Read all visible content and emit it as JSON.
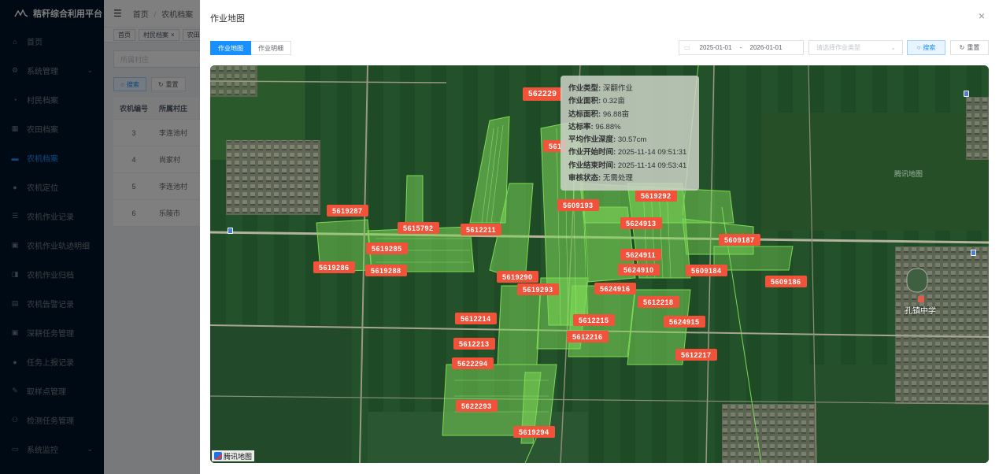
{
  "app": {
    "title": "秸秆综合利用平台"
  },
  "sidebar": {
    "items": [
      {
        "label": "首页",
        "icon": "home-icon",
        "glyph": "⌂"
      },
      {
        "label": "系统管理",
        "icon": "gear-icon",
        "glyph": "⚙",
        "arrow": "⌄"
      },
      {
        "label": "村民档案",
        "icon": "user-icon",
        "glyph": "◔"
      },
      {
        "label": "农田档案",
        "icon": "field-icon",
        "glyph": "▦"
      },
      {
        "label": "农机档案",
        "icon": "tractor-icon",
        "glyph": "▬",
        "active": true
      },
      {
        "label": "农机定位",
        "icon": "location-icon",
        "glyph": "●"
      },
      {
        "label": "农机作业记录",
        "icon": "record-icon",
        "glyph": "☰"
      },
      {
        "label": "农机作业轨迹明细",
        "icon": "track-icon",
        "glyph": "▣"
      },
      {
        "label": "农机作业归档",
        "icon": "archive-icon",
        "glyph": "◨"
      },
      {
        "label": "农机告警记录",
        "icon": "alarm-icon",
        "glyph": "▤"
      },
      {
        "label": "深耕任务管理",
        "icon": "task-icon",
        "glyph": "▣"
      },
      {
        "label": "任务上报记录",
        "icon": "report-icon",
        "glyph": "●"
      },
      {
        "label": "取样点管理",
        "icon": "sample-icon",
        "glyph": "✎"
      },
      {
        "label": "检测任务管理",
        "icon": "detect-icon",
        "glyph": "⚇"
      },
      {
        "label": "系统监控",
        "icon": "monitor-icon",
        "glyph": "▭",
        "arrow": "⌄"
      }
    ]
  },
  "background": {
    "breadcrumb": [
      "首页",
      "农机档案"
    ],
    "tags": [
      "首页",
      "村民档案",
      "农田"
    ],
    "filter_placeholder": "所属村庄",
    "search_label": "搜索",
    "reset_label": "重置",
    "table": {
      "headers": [
        "农机编号",
        "所属村庄"
      ],
      "rows": [
        [
          "3",
          "李连池村"
        ],
        [
          "4",
          "尚家村"
        ],
        [
          "5",
          "李连池村"
        ],
        [
          "6",
          "乐陵市"
        ]
      ]
    }
  },
  "modal": {
    "title": "作业地图",
    "close": "×",
    "tabs": [
      {
        "label": "作业地图",
        "active": true
      },
      {
        "label": "作业明细",
        "active": false
      }
    ],
    "date_start": "2025-01-01",
    "date_sep": "-",
    "date_end": "2026-01-01",
    "type_placeholder": "请选择作业类型",
    "search_label": "搜索",
    "reset_label": "重置"
  },
  "map": {
    "popup": [
      {
        "k": "作业类型",
        "v": "深翻作业"
      },
      {
        "k": "作业面积",
        "v": "0.32亩"
      },
      {
        "k": "达标面积",
        "v": "96.88亩"
      },
      {
        "k": "达标率",
        "v": "96.88%"
      },
      {
        "k": "平均作业深度",
        "v": "30.57cm"
      },
      {
        "k": "作业开始时间",
        "v": "2025-11-14 09:51:31"
      },
      {
        "k": "作业结束时间",
        "v": "2025-11-14 09:53:41"
      },
      {
        "k": "审核状态",
        "v": "无需处理"
      }
    ],
    "labels": [
      "562229",
      "561",
      "5619292",
      "5609193",
      "5619287",
      "5615792",
      "5612211",
      "5624913",
      "5609187",
      "5619285",
      "5624911",
      "5619286",
      "5619288",
      "5624910",
      "5609184",
      "5619290",
      "5609186",
      "5619293",
      "5624916",
      "5612218",
      "5612214",
      "5612215",
      "5624915",
      "5612216",
      "5612213",
      "5612217",
      "5622294",
      "5622293",
      "5619294"
    ],
    "village_label": "孔镇中学",
    "watermark": "腾讯地图",
    "logo_text": "腾讯地图",
    "label_color": "#f0523a",
    "track_color": "#7ed957"
  }
}
